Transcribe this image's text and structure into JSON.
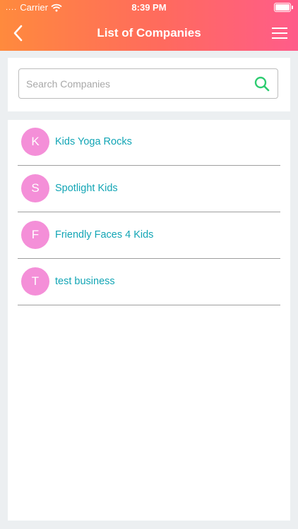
{
  "status_bar": {
    "signal": "....",
    "carrier": "Carrier",
    "time": "8:39 PM"
  },
  "header": {
    "title": "List of Companies",
    "back_icon": "chevron-left-icon",
    "menu_icon": "hamburger-menu-icon"
  },
  "search": {
    "placeholder": "Search Companies",
    "value": "",
    "icon": "search-icon"
  },
  "companies": [
    {
      "initial": "K",
      "name": "Kids Yoga Rocks"
    },
    {
      "initial": "S",
      "name": "Spotlight Kids"
    },
    {
      "initial": "F",
      "name": "Friendly Faces 4 Kids"
    },
    {
      "initial": "T",
      "name": "test business"
    }
  ],
  "colors": {
    "header_gradient_start": "#ff8a3d",
    "header_gradient_end": "#ff5c8a",
    "avatar": "#f48fd8",
    "company_name": "#12a5b5",
    "search_icon": "#2ecc71"
  }
}
